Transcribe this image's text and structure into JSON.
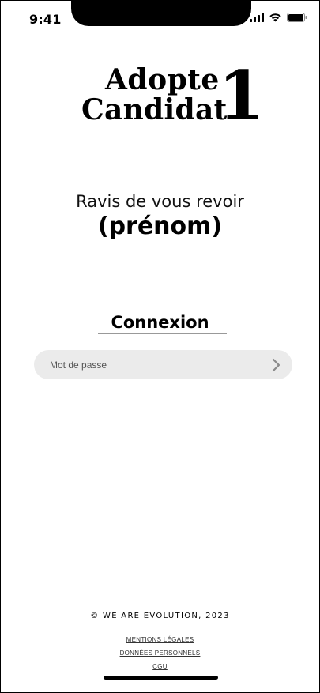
{
  "status_bar": {
    "time": "9:41",
    "icons": [
      "signal-icon",
      "wifi-icon",
      "battery-icon"
    ]
  },
  "logo": {
    "line1": "Adopte",
    "line2": "Candidat",
    "numeral": "1"
  },
  "greeting": {
    "text": "Ravis de vous revoir",
    "username": "(prénom)"
  },
  "login": {
    "title": "Connexion",
    "password_placeholder": "Mot de passe",
    "password_value": "",
    "submit_icon": "chevron-right-icon",
    "field_color": "#ebebeb"
  },
  "footer": {
    "copyright": "© WE ARE EVOLUTION,  2023",
    "links": [
      "MENTIONS LÉGALES",
      "DONNÉES PERSONNELS",
      "CGU"
    ]
  }
}
